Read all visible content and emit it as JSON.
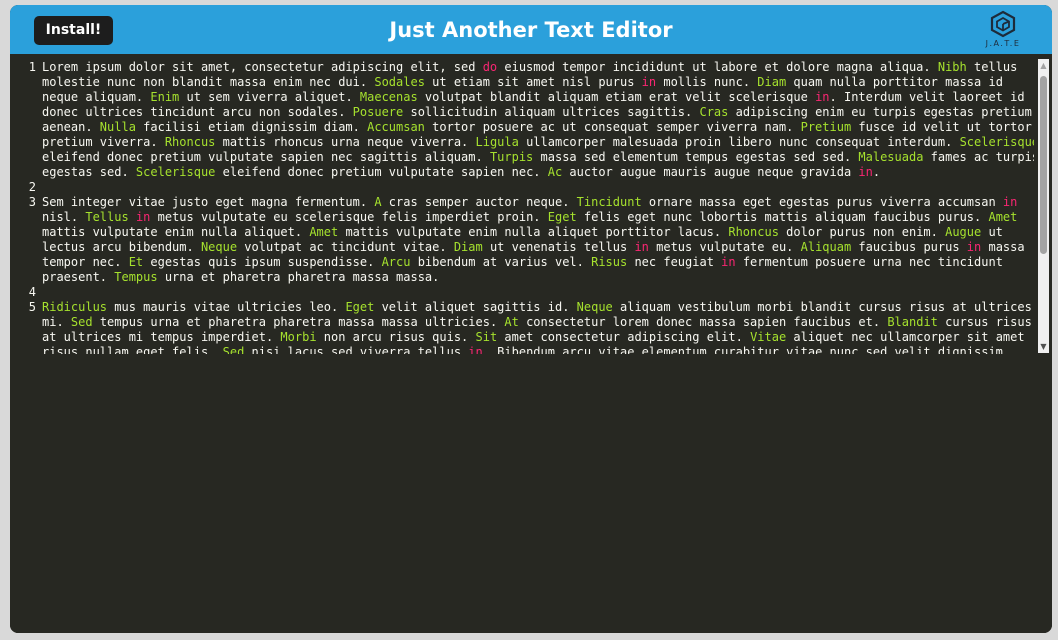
{
  "titlebar": {
    "install_label": "Install!",
    "title": "Just Another Text Editor",
    "logo_text": "J.A.T.E",
    "bg_color": "#2ba0db"
  },
  "editor": {
    "theme": "monokai",
    "colors": {
      "background": "#272822",
      "text": "#f8f8f2",
      "capitalized_word": "#a6e22e",
      "keyword": "#f92672"
    },
    "line_numbers": [
      "1",
      "2",
      "3",
      "4",
      "5"
    ],
    "rows": [
      {
        "num": "1",
        "segs": [
          [
            "Lorem ipsum dolor sit amet, consectetur adipiscing elit, sed ",
            ""
          ],
          [
            "do",
            "p"
          ],
          [
            " eiusmod tempor incididunt ut labore et dolore magna aliqua. ",
            ""
          ],
          [
            "Nibh",
            "g"
          ],
          [
            " tellus",
            ""
          ]
        ]
      },
      {
        "num": "",
        "segs": [
          [
            "molestie nunc non blandit massa enim nec dui. ",
            ""
          ],
          [
            "Sodales",
            "g"
          ],
          [
            " ut etiam sit amet nisl purus ",
            ""
          ],
          [
            "in",
            "p"
          ],
          [
            " mollis nunc. ",
            ""
          ],
          [
            "Diam",
            "g"
          ],
          [
            " quam nulla porttitor massa id",
            ""
          ]
        ]
      },
      {
        "num": "",
        "segs": [
          [
            "neque aliquam. ",
            ""
          ],
          [
            "Enim",
            "g"
          ],
          [
            " ut sem viverra aliquet. ",
            ""
          ],
          [
            "Maecenas",
            "g"
          ],
          [
            " volutpat blandit aliquam etiam erat velit scelerisque ",
            ""
          ],
          [
            "in",
            "p"
          ],
          [
            ". Interdum velit laoreet id",
            ""
          ]
        ]
      },
      {
        "num": "",
        "segs": [
          [
            "donec ultrices tincidunt arcu non sodales. ",
            ""
          ],
          [
            "Posuere",
            "g"
          ],
          [
            " sollicitudin aliquam ultrices sagittis. ",
            ""
          ],
          [
            "Cras",
            "g"
          ],
          [
            " adipiscing enim eu turpis egestas pretium",
            ""
          ]
        ]
      },
      {
        "num": "",
        "segs": [
          [
            "aenean. ",
            ""
          ],
          [
            "Nulla",
            "g"
          ],
          [
            " facilisi etiam dignissim diam. ",
            ""
          ],
          [
            "Accumsan",
            "g"
          ],
          [
            " tortor posuere ac ut consequat semper viverra nam. ",
            ""
          ],
          [
            "Pretium",
            "g"
          ],
          [
            " fusce id velit ut tortor",
            ""
          ]
        ]
      },
      {
        "num": "",
        "segs": [
          [
            "pretium viverra. ",
            ""
          ],
          [
            "Rhoncus",
            "g"
          ],
          [
            " mattis rhoncus urna neque viverra. ",
            ""
          ],
          [
            "Ligula",
            "g"
          ],
          [
            " ullamcorper malesuada proin libero nunc consequat interdum. ",
            ""
          ],
          [
            "Scelerisque",
            "g"
          ]
        ]
      },
      {
        "num": "",
        "segs": [
          [
            "eleifend donec pretium vulputate sapien nec sagittis aliquam. ",
            ""
          ],
          [
            "Turpis",
            "g"
          ],
          [
            " massa sed elementum tempus egestas sed sed. ",
            ""
          ],
          [
            "Malesuada",
            "g"
          ],
          [
            " fames ac turpis",
            ""
          ]
        ]
      },
      {
        "num": "",
        "segs": [
          [
            "egestas sed. ",
            ""
          ],
          [
            "Scelerisque",
            "g"
          ],
          [
            " eleifend donec pretium vulputate sapien nec. ",
            ""
          ],
          [
            "Ac",
            "g"
          ],
          [
            " auctor augue mauris augue neque gravida ",
            ""
          ],
          [
            "in",
            "p"
          ],
          [
            ".",
            ""
          ]
        ]
      },
      {
        "num": "2",
        "segs": []
      },
      {
        "num": "3",
        "segs": [
          [
            "Sem integer vitae justo eget magna fermentum. ",
            ""
          ],
          [
            "A",
            "g"
          ],
          [
            " cras semper auctor neque. ",
            ""
          ],
          [
            "Tincidunt",
            "g"
          ],
          [
            " ornare massa eget egestas purus viverra accumsan ",
            ""
          ],
          [
            "in",
            "p"
          ]
        ]
      },
      {
        "num": "",
        "segs": [
          [
            "nisl. ",
            ""
          ],
          [
            "Tellus",
            "g"
          ],
          [
            " ",
            ""
          ],
          [
            "in",
            "p"
          ],
          [
            " metus vulputate eu scelerisque felis imperdiet proin. ",
            ""
          ],
          [
            "Eget",
            "g"
          ],
          [
            " felis eget nunc lobortis mattis aliquam faucibus purus. ",
            ""
          ],
          [
            "Amet",
            "g"
          ]
        ]
      },
      {
        "num": "",
        "segs": [
          [
            "mattis vulputate enim nulla aliquet. ",
            ""
          ],
          [
            "Amet",
            "g"
          ],
          [
            " mattis vulputate enim nulla aliquet porttitor lacus. ",
            ""
          ],
          [
            "Rhoncus",
            "g"
          ],
          [
            " dolor purus non enim. ",
            ""
          ],
          [
            "Augue",
            "g"
          ],
          [
            " ut",
            ""
          ]
        ]
      },
      {
        "num": "",
        "segs": [
          [
            "lectus arcu bibendum. ",
            ""
          ],
          [
            "Neque",
            "g"
          ],
          [
            " volutpat ac tincidunt vitae. ",
            ""
          ],
          [
            "Diam",
            "g"
          ],
          [
            " ut venenatis tellus ",
            ""
          ],
          [
            "in",
            "p"
          ],
          [
            " metus vulputate eu. ",
            ""
          ],
          [
            "Aliquam",
            "g"
          ],
          [
            " faucibus purus ",
            ""
          ],
          [
            "in",
            "p"
          ],
          [
            " massa",
            ""
          ]
        ]
      },
      {
        "num": "",
        "segs": [
          [
            "tempor nec. ",
            ""
          ],
          [
            "Et",
            "g"
          ],
          [
            " egestas quis ipsum suspendisse. ",
            ""
          ],
          [
            "Arcu",
            "g"
          ],
          [
            " bibendum at varius vel. ",
            ""
          ],
          [
            "Risus",
            "g"
          ],
          [
            " nec feugiat ",
            ""
          ],
          [
            "in",
            "p"
          ],
          [
            " fermentum posuere urna nec tincidunt",
            ""
          ]
        ]
      },
      {
        "num": "",
        "segs": [
          [
            "praesent. ",
            ""
          ],
          [
            "Tempus",
            "g"
          ],
          [
            " urna et pharetra pharetra massa massa.",
            ""
          ]
        ]
      },
      {
        "num": "4",
        "segs": []
      },
      {
        "num": "5",
        "segs": [
          [
            "Ridiculus",
            "g"
          ],
          [
            " mus mauris vitae ultricies leo. ",
            ""
          ],
          [
            "Eget",
            "g"
          ],
          [
            " velit aliquet sagittis id. ",
            ""
          ],
          [
            "Neque",
            "g"
          ],
          [
            " aliquam vestibulum morbi blandit cursus risus at ultrices",
            ""
          ]
        ]
      },
      {
        "num": "",
        "segs": [
          [
            "mi. ",
            ""
          ],
          [
            "Sed",
            "g"
          ],
          [
            " tempus urna et pharetra pharetra massa massa ultricies. ",
            ""
          ],
          [
            "At",
            "g"
          ],
          [
            " consectetur lorem donec massa sapien faucibus et. ",
            ""
          ],
          [
            "Blandit",
            "g"
          ],
          [
            " cursus risus",
            ""
          ]
        ]
      },
      {
        "num": "",
        "segs": [
          [
            "at ultrices mi tempus imperdiet. ",
            ""
          ],
          [
            "Morbi",
            "g"
          ],
          [
            " non arcu risus quis. ",
            ""
          ],
          [
            "Sit",
            "g"
          ],
          [
            " amet consectetur adipiscing elit. ",
            ""
          ],
          [
            "Vitae",
            "g"
          ],
          [
            " aliquet nec ullamcorper sit amet",
            ""
          ]
        ]
      },
      {
        "num": "",
        "segs": [
          [
            "risus nullam eget felis. ",
            ""
          ],
          [
            "Sed",
            "g"
          ],
          [
            " nisi lacus sed viverra tellus ",
            ""
          ],
          [
            "in",
            "p"
          ],
          [
            ". Bibendum arcu vitae elementum curabitur vitae nunc sed velit dignissim.",
            ""
          ]
        ]
      }
    ]
  },
  "scrollbar": {
    "up_icon": "▲",
    "down_icon": "▼"
  }
}
